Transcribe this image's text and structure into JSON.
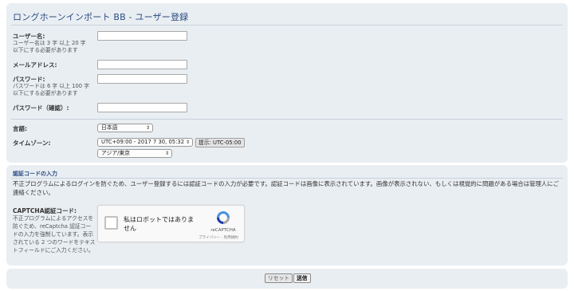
{
  "header": {
    "title": "ロングホーンインポート BB - ユーザー登録"
  },
  "form": {
    "username": {
      "label": "ユーザー名:",
      "hint_line1": "ユーザー名は 3 字 以上 20 字",
      "hint_line2": "以下にする必要があります",
      "value": ""
    },
    "email": {
      "label": "メールアドレス:",
      "value": ""
    },
    "password": {
      "label": "パスワード:",
      "hint_line1": "パスワードは 6 字 以上 100 字",
      "hint_line2": "以下にする必要があります",
      "value": ""
    },
    "password_confirm": {
      "label": "パスワード（確認）:",
      "value": ""
    },
    "language": {
      "label": "言語:",
      "selected": "日本語"
    },
    "timezone": {
      "label": "タイムゾーン:",
      "selected": "UTC+09:00 - 2017 7 30, 05:32",
      "region": "アジア/東京",
      "hint_button": "提示: UTC-05:00"
    }
  },
  "confirm": {
    "heading": "認証コードの入力",
    "description": "不正プログラムによるログインを防ぐため、ユーザー登録するには認証コードの入力が必要です。認証コードは画像に表示されています。画像が表示されない、もしくは視覚的に問題がある場合は管理人にご連絡ください。",
    "captcha_label": "CAPTCHA認証コード:",
    "captcha_hint": "不正プログラムによるアクセスを防ぐため、reCaptcha 認証コードの入力を強制しています。表示されている 2 つのワードをテキストフィールドにご入力ください。",
    "recaptcha": {
      "checkbox_text": "私はロボットではありません",
      "brand": "reCAPTCHA",
      "links": "プライバシー - 利用規約"
    }
  },
  "actions": {
    "reset_label": "リセット",
    "submit_label": "送信"
  },
  "colors": {
    "panel_bg": "#e9eef2",
    "title_blue": "#2a4a82"
  }
}
